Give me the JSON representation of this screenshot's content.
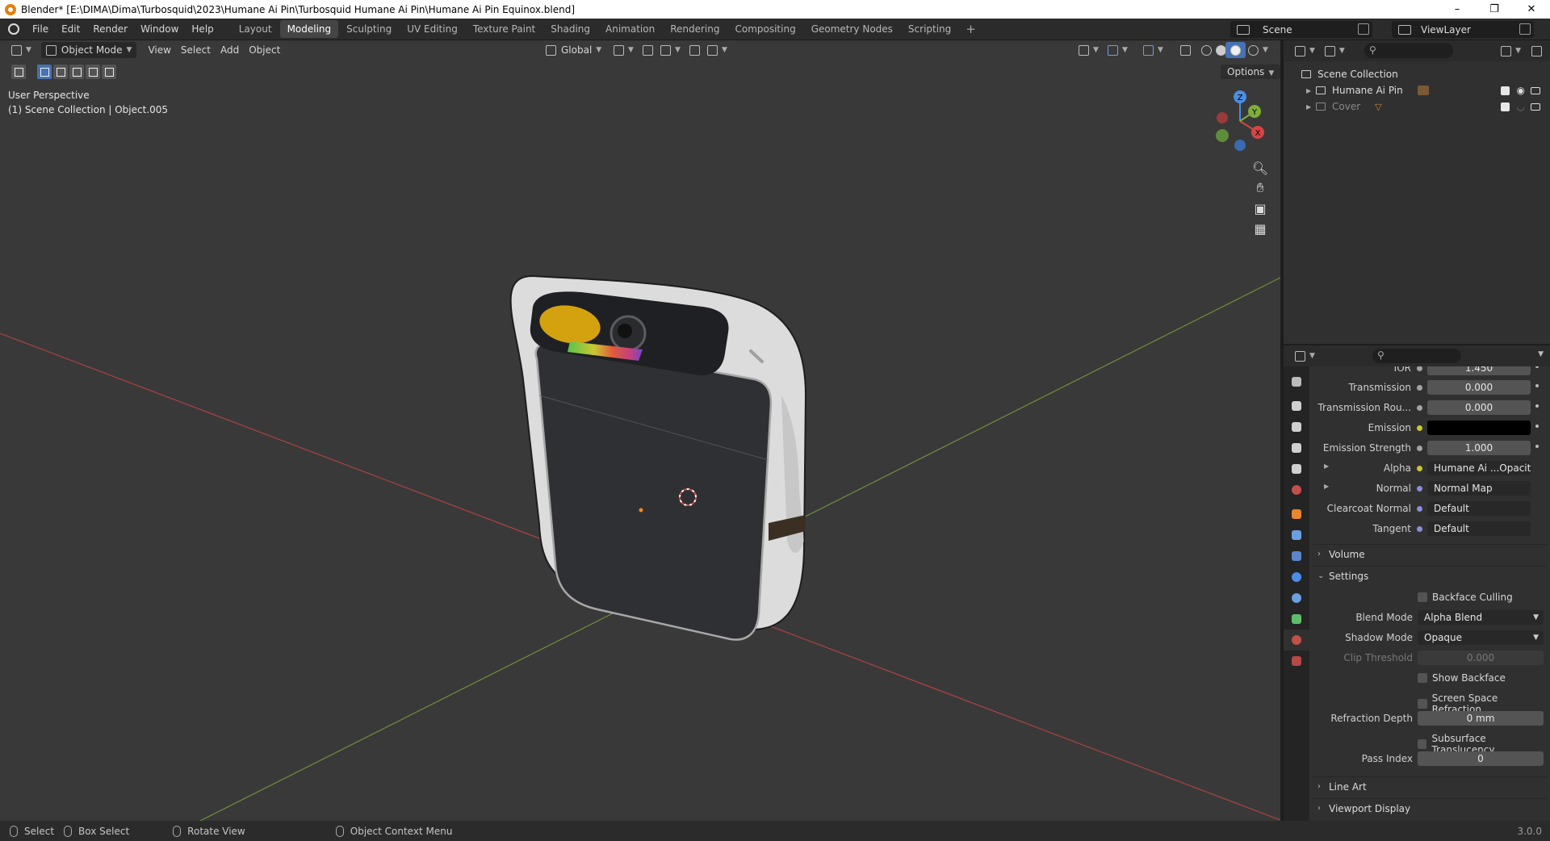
{
  "titlebar": {
    "title": "Blender* [E:\\DIMA\\Dima\\Turbosquid\\2023\\Humane Ai Pin\\Turbosquid Humane Ai Pin\\Humane Ai Pin Equinox.blend]",
    "minimize": "–",
    "maximize": "❐",
    "close": "✕"
  },
  "menu": [
    "File",
    "Edit",
    "Render",
    "Window",
    "Help"
  ],
  "workspaces": [
    "Layout",
    "Modeling",
    "Sculpting",
    "UV Editing",
    "Texture Paint",
    "Shading",
    "Animation",
    "Rendering",
    "Compositing",
    "Geometry Nodes",
    "Scripting"
  ],
  "active_workspace": "Modeling",
  "add_workspace": "+",
  "scene": "Scene",
  "view_layer": "ViewLayer",
  "viewport": {
    "mode": "Object Mode",
    "menus": [
      "View",
      "Select",
      "Add",
      "Object"
    ],
    "transform_orientation": "Global",
    "options": "Options",
    "info_line1": "User Perspective",
    "info_line2": "(1) Scene Collection | Object.005",
    "gizmo": {
      "x": "X",
      "y": "Y",
      "z": "Z"
    }
  },
  "outliner": {
    "root": "Scene Collection",
    "items": [
      {
        "label": "Humane Ai Pin",
        "dim": false
      },
      {
        "label": "Cover",
        "dim": true
      }
    ]
  },
  "properties": {
    "rows": [
      {
        "label": "IOR",
        "value": "1.450",
        "dot": "gray"
      },
      {
        "label": "Transmission",
        "value": "0.000",
        "dot": "gray"
      },
      {
        "label": "Transmission Rou...",
        "value": "0.000",
        "dot": "gray"
      },
      {
        "label": "Emission",
        "value": "",
        "dot": "yellow"
      },
      {
        "label": "Emission Strength",
        "value": "1.000",
        "dot": "gray"
      },
      {
        "label": "Alpha",
        "value": "Humane Ai ...Opacity.png",
        "dot": "yellow"
      },
      {
        "label": "Normal",
        "value": "Normal Map",
        "dot": "blue"
      },
      {
        "label": "Clearcoat Normal",
        "value": "Default",
        "dot": "blue"
      },
      {
        "label": "Tangent",
        "value": "Default",
        "dot": "blue"
      }
    ],
    "sections": {
      "volume": "Volume",
      "settings": "Settings",
      "line_art": "Line Art",
      "viewport_display": "Viewport Display"
    },
    "settings": {
      "backface_culling": "Backface Culling",
      "blend_mode_label": "Blend Mode",
      "blend_mode": "Alpha Blend",
      "shadow_mode_label": "Shadow Mode",
      "shadow_mode": "Opaque",
      "clip_threshold_label": "Clip Threshold",
      "clip_threshold": "0.000",
      "show_backface": "Show Backface",
      "screen_space_refraction": "Screen Space Refraction",
      "refraction_depth_label": "Refraction Depth",
      "refraction_depth": "0 mm",
      "subsurface_translucency": "Subsurface Translucency",
      "pass_index_label": "Pass Index",
      "pass_index": "0"
    }
  },
  "statusbar": {
    "select": "Select",
    "box_select": "Box Select",
    "rotate_view": "Rotate View",
    "context_menu": "Object Context Menu",
    "version": "3.0.0"
  },
  "colors": {
    "accent": "#4772b3",
    "x_axis": "#d64545",
    "y_axis": "#7fad3a",
    "z_axis": "#4a8ee6",
    "viewport_bg": "#393939"
  }
}
